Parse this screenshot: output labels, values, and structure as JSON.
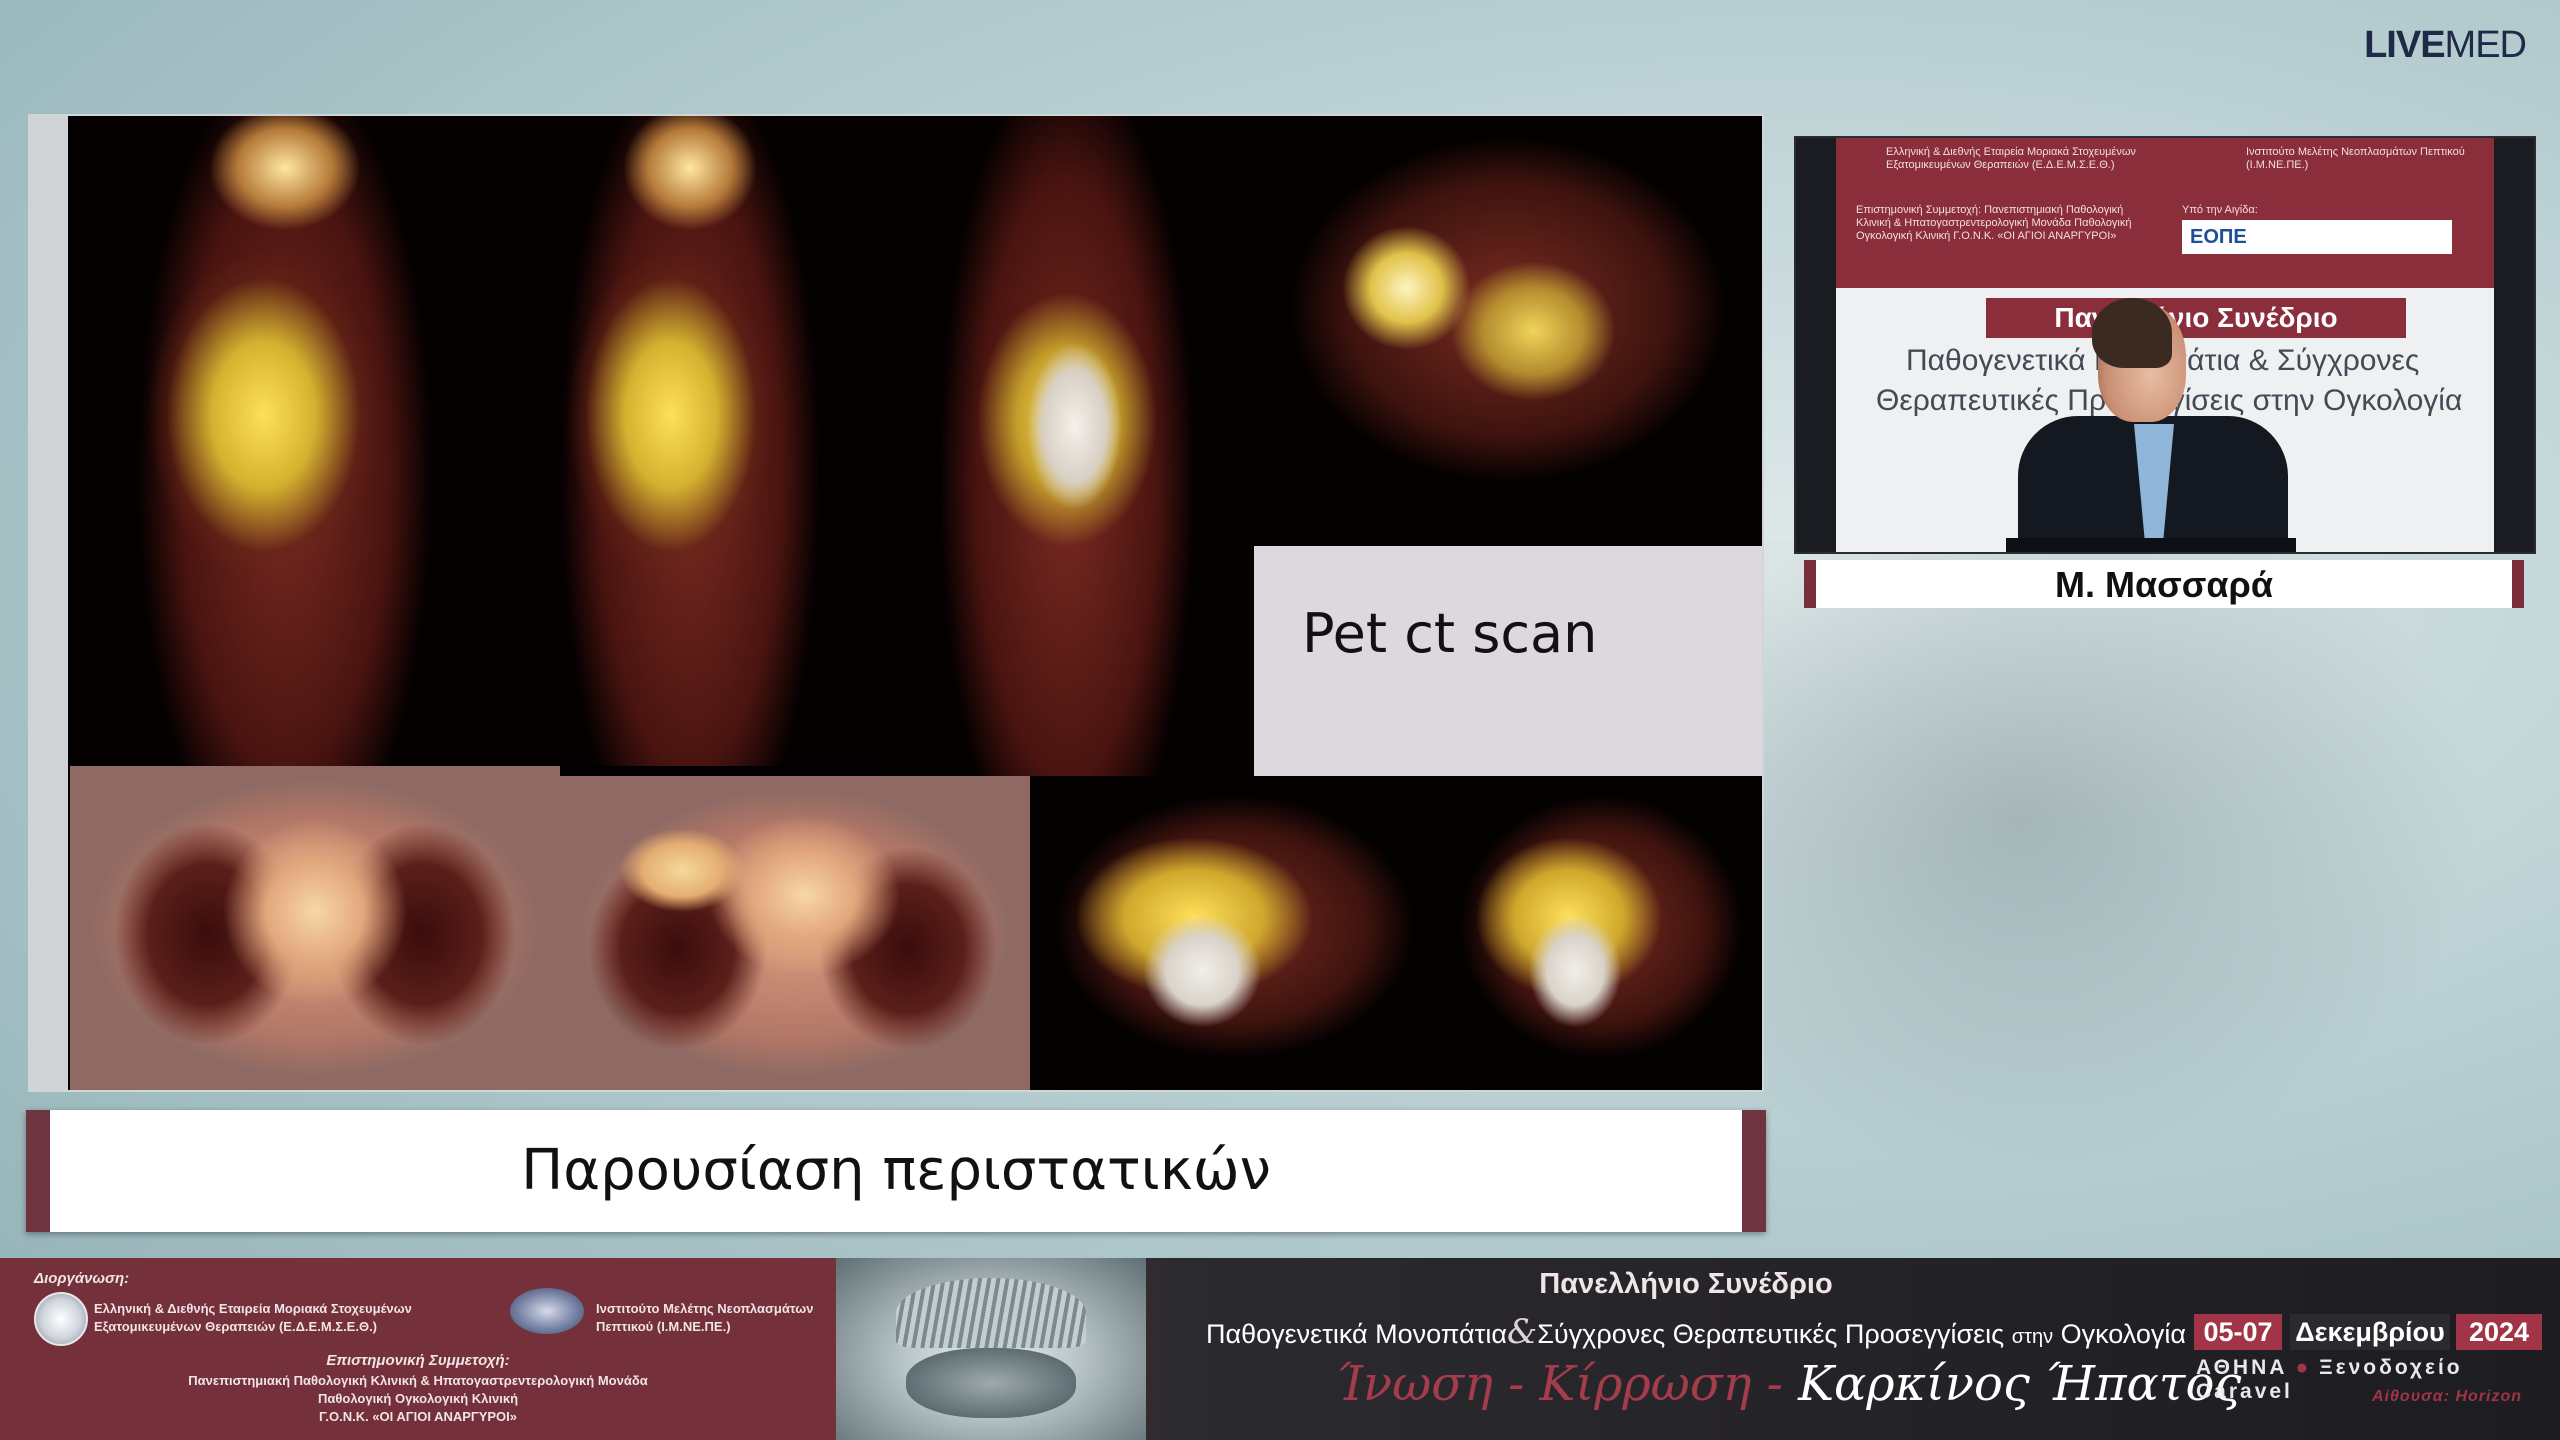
{
  "brand": {
    "prefix": "LIVE",
    "suffix": "MED"
  },
  "slide": {
    "label": "Pet ct scan",
    "title": "Παρουσίαση περιστατικών",
    "images": [
      "coronal-1",
      "coronal-2",
      "coronal-3",
      "axial-upper-abdomen",
      "axial-chest-1",
      "axial-chest-2",
      "axial-abdomen-1",
      "axial-abdomen-2"
    ]
  },
  "video": {
    "org1": "Ελληνική & Διεθνής Εταιρεία Μοριακά Στοχευμένων Εξατομικευμένων Θεραπειών (Ε.Δ.Ε.Μ.Σ.Ε.Θ.)",
    "org2": "Ινστιτούτο Μελέτης Νεοπλασμάτων Πεπτικού (Ι.Μ.ΝΕ.ΠΕ.)",
    "sci": "Επιστημονική Συμμετοχή: Πανεπιστημιακή Παθολογική Κλινική & Ηπατογαστρεντερολογική Μονάδα Παθολογική Ογκολογική Κλινική Γ.Ο.Ν.Κ. «ΟΙ ΑΓΙΟΙ ΑΝΑΡΓΥΡΟΙ»",
    "auspices": "Υπό την Αιγίδα:",
    "auspices_logo": "ΕΟΠΕ",
    "slide_title": "Πανελλήνιο Συνέδριο",
    "slide_line1": "Παθογενετικά Μονοπάτια & Σύγχρονες",
    "slide_line2": "Θεραπευτικές Προσεγγίσεις στην Ογκολογία"
  },
  "speaker": {
    "name": "Μ. Μασσαρά"
  },
  "banner": {
    "organizers_heading": "Διοργάνωση:",
    "org1_line1": "Ελληνική & Διεθνής Εταιρεία Μοριακά Στοχευμένων",
    "org1_line2": "Εξατομικευμένων Θεραπειών (Ε.Δ.Ε.Μ.Σ.Ε.Θ.)",
    "org2_line1": "Ινστιτούτο Μελέτης Νεοπλασμάτων",
    "org2_line2": "Πεπτικού (Ι.Μ.ΝΕ.ΠΕ.)",
    "sci_heading": "Επιστημονική Συμμετοχή:",
    "sci_line1": "Πανεπιστημιακή Παθολογική Κλινική & Ηπατογαστρεντερολογική Μονάδα",
    "sci_line2": "Παθολογική Ογκολογική Κλινική",
    "sci_line3": "Γ.Ο.Ν.Κ. «ΟΙ ΑΓΙΟΙ ΑΝΑΡΓΥΡΟΙ»",
    "conference": "Πανελλήνιο Συνέδριο",
    "subtitle_a": "Παθογενετικά Μονοπάτια",
    "subtitle_amp": "&",
    "subtitle_b": "Σύγχρονες Θεραπευτικές Προσεγγίσεις",
    "subtitle_small": "στην",
    "subtitle_c": "Ογκολογία",
    "topic_a": "Ίνωση - Κίρρωση -",
    "topic_b": "Καρκίνος Ήπατος",
    "date_days": "05-07",
    "date_month": "Δεκεμβρίου",
    "date_year": "2024",
    "city": "ΑΘΗΝΑ",
    "venue": "Ξενοδοχείο Caravel",
    "room": "Αίθουσα: Horizon"
  },
  "colors": {
    "accent": "#7a2f3b",
    "accent_bright": "#a13446",
    "brand": "#1e2a47"
  }
}
